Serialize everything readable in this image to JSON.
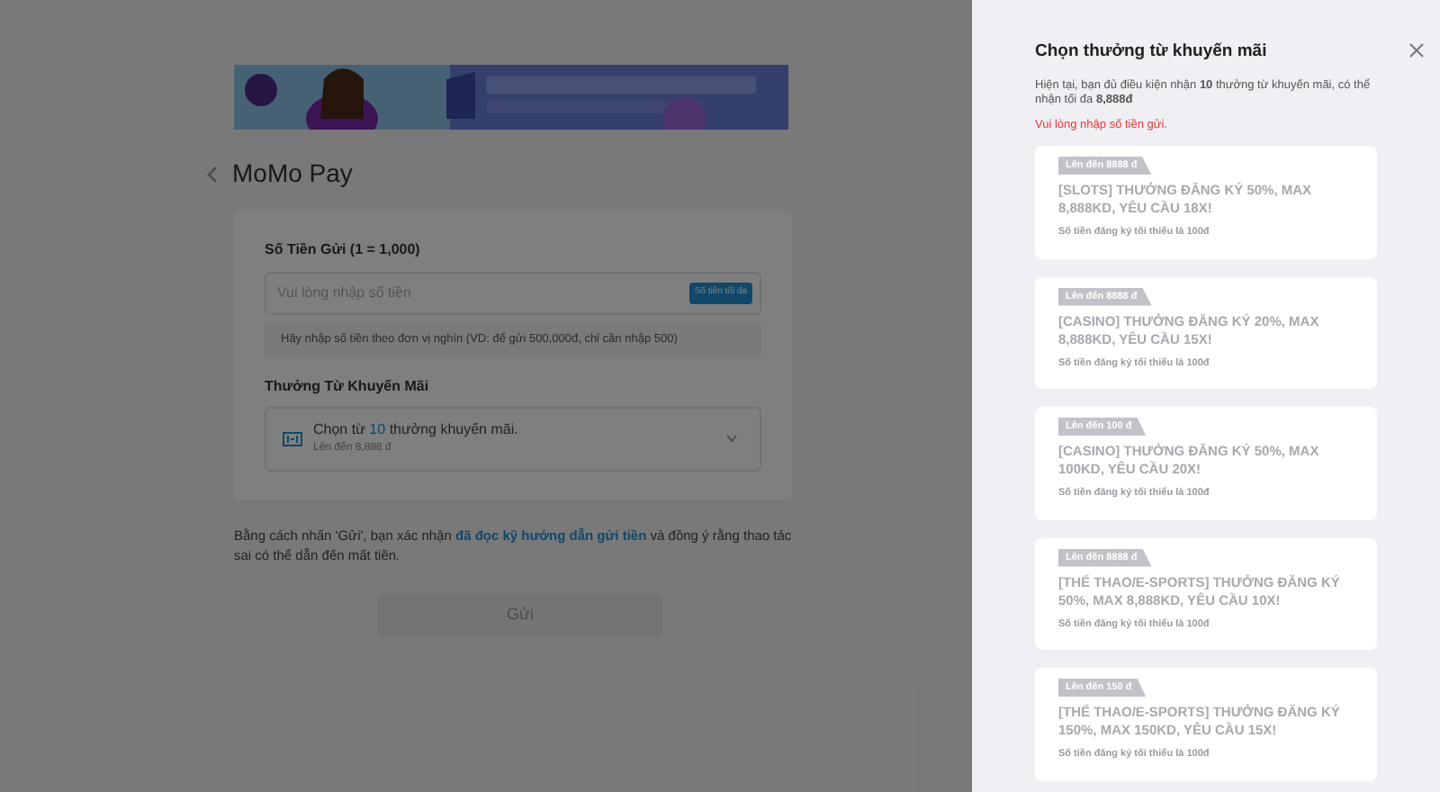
{
  "page": {
    "title": "MoMo Pay"
  },
  "deposit": {
    "label": "Số Tiền Gửi (1 = 1,000)",
    "placeholder": "Vui lòng nhập số tiền",
    "max_button": "Số tiền tối đa",
    "hint": "Hãy nhập số tiền theo đơn vị nghìn (VD: để gửi 500,000đ, chỉ cần nhập 500)"
  },
  "promo": {
    "label": "Thưởng Từ Khuyến Mãi",
    "select_prefix": "Chọn từ",
    "select_count": "10",
    "select_suffix": "thưởng khuyến mãi.",
    "select_sub": "Lên đến 8,888 đ",
    "expanded": false
  },
  "disclaimer": {
    "before": "Bằng cách nhấn 'Gửi', bạn xác nhận",
    "link": "đã đọc kỹ hướng dẫn gửi tiền",
    "after": "và đồng ý rằng thao tác sai có thể dẫn đến mất tiền."
  },
  "submit": {
    "label": "Gửi",
    "disabled": true
  },
  "drawer": {
    "title": "Chọn thưởng từ khuyến mãi",
    "info": "Hiện tại, bạn đủ điều kiện nhận **10** thưởng từ khuyến mãi, có thể nhận tối đa **8,888đ**",
    "error": "Vui lòng nhập số tiền gửi.",
    "cards": [
      {
        "tag": "Lên đến 8888 đ",
        "title": "[SLOTS] THƯỞNG ĐĂNG KÝ 50%, MAX 8,888KD, YÊU CẦU 18X!",
        "note": "Số tiền đăng ký tối thiểu là 100đ",
        "disabled": true
      },
      {
        "tag": "Lên đến 8888 đ",
        "title": "[CASINO] THƯỞNG ĐĂNG KÝ 20%, MAX 8,888KD, YÊU CẦU 15X!",
        "note": "Số tiền đăng ký tối thiểu là 100đ",
        "disabled": true
      },
      {
        "tag": "Lên đến 100 đ",
        "title": "[CASINO] THƯỞNG ĐĂNG KÝ 50%, MAX 100KD, YÊU CẦU 20X!",
        "note": "Số tiền đăng ký tối thiểu là 100đ",
        "disabled": true
      },
      {
        "tag": "Lên đến 8888 đ",
        "title": "[THỂ THAO/E-SPORTS] THƯỞNG ĐĂNG KÝ 50%, MAX 8,888KD, YÊU CẦU 10X!",
        "note": "Số tiền đăng ký tối thiểu là 100đ",
        "disabled": true
      },
      {
        "tag": "Lên đến 150 đ",
        "title": "[THỂ THAO/E-SPORTS] THƯỞNG ĐĂNG KÝ 150%, MAX 150KD, YÊU CẦU 15X!",
        "note": "Số tiền đăng ký tối thiểu là 100đ",
        "disabled": true
      }
    ]
  }
}
